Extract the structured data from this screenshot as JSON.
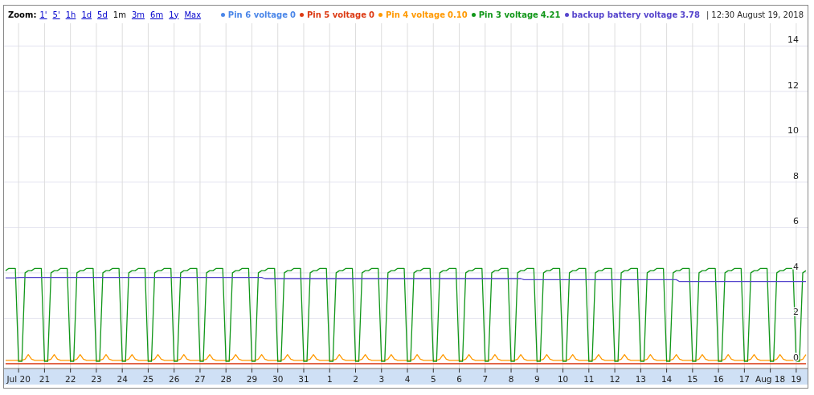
{
  "zoom": {
    "label": "Zoom:",
    "options": [
      {
        "label": "1'",
        "selected": false
      },
      {
        "label": "5'",
        "selected": false
      },
      {
        "label": "1h",
        "selected": false
      },
      {
        "label": "1d",
        "selected": false
      },
      {
        "label": "5d",
        "selected": false
      },
      {
        "label": "1m",
        "selected": true
      },
      {
        "label": "3m",
        "selected": false
      },
      {
        "label": "6m",
        "selected": false
      },
      {
        "label": "1y",
        "selected": false
      },
      {
        "label": "Max",
        "selected": false
      }
    ]
  },
  "legend": [
    {
      "value": "0"
    },
    {
      "value": "0"
    },
    {
      "value": "0.10"
    },
    {
      "value": "4.21"
    },
    {
      "value": "3.78"
    }
  ],
  "separator": "|",
  "timestamp": "12:30 August 19, 2018",
  "chart_data": {
    "type": "line",
    "grid": true,
    "ylim": [
      0,
      15
    ],
    "yticks": [
      0,
      2,
      4,
      6,
      8,
      10,
      12,
      14
    ],
    "categories": [
      null,
      null,
      null,
      null,
      "Jul 20",
      null,
      null,
      null,
      null,
      null,
      null,
      null,
      "21",
      null,
      null,
      null,
      null,
      null,
      null,
      null,
      "22",
      null,
      null,
      null,
      null,
      null,
      null,
      null,
      "23",
      null,
      null,
      null,
      null,
      null,
      null,
      null,
      "24",
      null,
      null,
      null,
      null,
      null,
      null,
      null,
      "25",
      null,
      null,
      null,
      null,
      null,
      null,
      null,
      "26",
      null,
      null,
      null,
      null,
      null,
      null,
      null,
      "27",
      null,
      null,
      null,
      null,
      null,
      null,
      null,
      "28",
      null,
      null,
      null,
      null,
      null,
      null,
      null,
      "29",
      null,
      null,
      null,
      null,
      null,
      null,
      null,
      "30",
      null,
      null,
      null,
      null,
      null,
      null,
      null,
      "31",
      null,
      null,
      null,
      null,
      null,
      null,
      null,
      "1",
      null,
      null,
      null,
      null,
      null,
      null,
      null,
      "2",
      null,
      null,
      null,
      null,
      null,
      null,
      null,
      "3",
      null,
      null,
      null,
      null,
      null,
      null,
      null,
      "4",
      null,
      null,
      null,
      null,
      null,
      null,
      null,
      "5",
      null,
      null,
      null,
      null,
      null,
      null,
      null,
      "6",
      null,
      null,
      null,
      null,
      null,
      null,
      null,
      "7",
      null,
      null,
      null,
      null,
      null,
      null,
      null,
      "8",
      null,
      null,
      null,
      null,
      null,
      null,
      null,
      "9",
      null,
      null,
      null,
      null,
      null,
      null,
      null,
      "10",
      null,
      null,
      null,
      null,
      null,
      null,
      null,
      "11",
      null,
      null,
      null,
      null,
      null,
      null,
      null,
      "12",
      null,
      null,
      null,
      null,
      null,
      null,
      null,
      "13",
      null,
      null,
      null,
      null,
      null,
      null,
      null,
      "14",
      null,
      null,
      null,
      null,
      null,
      null,
      null,
      "15",
      null,
      null,
      null,
      null,
      null,
      null,
      null,
      "16",
      null,
      null,
      null,
      null,
      null,
      null,
      null,
      "17",
      null,
      null,
      null,
      null,
      null,
      null,
      null,
      "Aug 18",
      null,
      null,
      null,
      null,
      null,
      null,
      null,
      "19",
      null,
      null,
      null
    ],
    "series": [
      {
        "name": "Pin 6 voltage",
        "color": "#4a86e8",
        "values": [
          null,
          null,
          null,
          null,
          null,
          null,
          null,
          null,
          null,
          null,
          null,
          null,
          null,
          null,
          null,
          null,
          null,
          null,
          null,
          null,
          null,
          null,
          null,
          null,
          null,
          null,
          null,
          null,
          null,
          null,
          null,
          null,
          null,
          null,
          null,
          null,
          null,
          null,
          null,
          null,
          null,
          null,
          null,
          null,
          null,
          null,
          null,
          null,
          null,
          null,
          null,
          null,
          null,
          null,
          null,
          null,
          null,
          null,
          null,
          null,
          null,
          null,
          null,
          null,
          null,
          null,
          null,
          null,
          null,
          null,
          null,
          null,
          null,
          null,
          null,
          null,
          null,
          null,
          null,
          null,
          null,
          null,
          null,
          null,
          null,
          null,
          null,
          null,
          null,
          null,
          null,
          null,
          null,
          null,
          null,
          null,
          null,
          null,
          null,
          null,
          null,
          null,
          null,
          null,
          null,
          null,
          null,
          null,
          null,
          null,
          null,
          null,
          null,
          null,
          null,
          null,
          null,
          null,
          null,
          null,
          null,
          null,
          null,
          null,
          null,
          null,
          null,
          null,
          null,
          null,
          null,
          null,
          null,
          null,
          null,
          null,
          null,
          null,
          null,
          null,
          null,
          null,
          null,
          null,
          null,
          null,
          null,
          null,
          null,
          null,
          null,
          null,
          null,
          null,
          null,
          null,
          null,
          null,
          null,
          null,
          null,
          null,
          null,
          null,
          null,
          null,
          null,
          null,
          null,
          null,
          null,
          null,
          null,
          null,
          null,
          null,
          null,
          null,
          null,
          null,
          null,
          null,
          null,
          null,
          null,
          null,
          null,
          null,
          null,
          null,
          null,
          null,
          null,
          null,
          null,
          null,
          null,
          null,
          null,
          null,
          null,
          null,
          null,
          null,
          null,
          null,
          null,
          null,
          null,
          null,
          null,
          null,
          null,
          null,
          null,
          null,
          null,
          null,
          null,
          null,
          null,
          null,
          null,
          null,
          null,
          null,
          null,
          null,
          null,
          null,
          null,
          null,
          null,
          null,
          null,
          null,
          null,
          null,
          null,
          null,
          null,
          null,
          null,
          null,
          null,
          null,
          null,
          null
        ]
      },
      {
        "name": "Pin 5 voltage",
        "color": "#dc3912",
        "values": [
          0,
          0,
          0,
          0,
          0,
          0,
          0,
          0,
          0,
          0,
          0,
          0,
          0,
          0,
          0,
          0,
          0,
          0,
          0,
          0,
          0,
          0,
          0,
          0,
          0,
          0,
          0,
          0,
          0,
          0,
          0,
          0,
          0,
          0,
          0,
          0,
          0,
          0,
          0,
          0,
          0,
          0,
          0,
          0,
          0,
          0,
          0,
          0,
          0,
          0,
          0,
          0,
          0,
          0,
          0,
          0,
          0,
          0,
          0,
          0,
          0,
          0,
          0,
          0,
          0,
          0,
          0,
          0,
          0,
          0,
          0,
          0,
          0,
          0,
          0,
          0,
          0,
          0,
          0,
          0,
          0,
          0,
          0,
          0,
          0,
          0,
          0,
          0,
          0,
          0,
          0,
          0,
          0,
          0,
          0,
          0,
          0,
          0,
          0,
          0,
          0,
          0,
          0,
          0,
          0,
          0,
          0,
          0,
          0,
          0,
          0,
          0,
          0,
          0,
          0,
          0,
          0,
          0,
          0,
          0,
          0,
          0,
          0,
          0,
          0,
          0,
          0,
          0,
          0,
          0,
          0,
          0,
          0,
          0,
          0,
          0,
          0,
          0,
          0,
          0,
          0,
          0,
          0,
          0,
          0,
          0,
          0,
          0,
          0,
          0,
          0,
          0,
          0,
          0,
          0,
          0,
          0,
          0,
          0,
          0,
          0,
          0,
          0,
          0,
          0,
          0,
          0,
          0,
          0,
          0,
          0,
          0,
          0,
          0,
          0,
          0,
          0,
          0,
          0,
          0,
          0,
          0,
          0,
          0,
          0,
          0,
          0,
          0,
          0,
          0,
          0,
          0,
          0,
          0,
          0,
          0,
          0,
          0,
          0,
          0,
          0,
          0,
          0,
          0,
          0,
          0,
          0,
          0,
          0,
          0,
          0,
          0,
          0,
          0,
          0,
          0,
          0,
          0,
          0,
          0,
          0,
          0,
          0,
          0,
          0,
          0,
          0,
          0,
          0,
          0,
          0,
          0,
          0,
          0,
          0,
          0,
          0,
          0,
          0,
          0,
          0,
          0,
          0,
          0,
          0,
          0,
          0,
          0
        ]
      },
      {
        "name": "Pin 4 voltage",
        "color": "#ff9900",
        "values": [
          0.15,
          0.15,
          0.15,
          0.15,
          0.15,
          0.15,
          0.2,
          0.4,
          0.2,
          0.15,
          0.15,
          0.15,
          0.15,
          0.15,
          0.2,
          0.4,
          0.2,
          0.15,
          0.15,
          0.15,
          0.15,
          0.15,
          0.2,
          0.4,
          0.2,
          0.15,
          0.15,
          0.15,
          0.15,
          0.15,
          0.2,
          0.4,
          0.2,
          0.15,
          0.15,
          0.15,
          0.15,
          0.15,
          0.2,
          0.4,
          0.2,
          0.15,
          0.15,
          0.15,
          0.15,
          0.15,
          0.2,
          0.4,
          0.2,
          0.15,
          0.15,
          0.15,
          0.15,
          0.15,
          0.2,
          0.4,
          0.2,
          0.15,
          0.15,
          0.15,
          0.15,
          0.15,
          0.2,
          0.4,
          0.2,
          0.15,
          0.15,
          0.15,
          0.15,
          0.15,
          0.2,
          0.4,
          0.2,
          0.15,
          0.15,
          0.15,
          0.15,
          0.15,
          0.2,
          0.4,
          0.2,
          0.15,
          0.15,
          0.15,
          0.15,
          0.15,
          0.2,
          0.4,
          0.2,
          0.15,
          0.15,
          0.15,
          0.15,
          0.15,
          0.2,
          0.4,
          0.2,
          0.15,
          0.15,
          0.15,
          0.15,
          0.15,
          0.2,
          0.4,
          0.2,
          0.15,
          0.15,
          0.15,
          0.15,
          0.15,
          0.2,
          0.4,
          0.2,
          0.15,
          0.15,
          0.15,
          0.15,
          0.15,
          0.2,
          0.4,
          0.2,
          0.15,
          0.15,
          0.15,
          0.15,
          0.15,
          0.2,
          0.4,
          0.2,
          0.15,
          0.15,
          0.15,
          0.15,
          0.15,
          0.2,
          0.4,
          0.2,
          0.15,
          0.15,
          0.15,
          0.15,
          0.15,
          0.2,
          0.4,
          0.2,
          0.15,
          0.15,
          0.15,
          0.15,
          0.15,
          0.2,
          0.4,
          0.2,
          0.15,
          0.15,
          0.15,
          0.15,
          0.15,
          0.2,
          0.4,
          0.2,
          0.15,
          0.15,
          0.15,
          0.15,
          0.15,
          0.2,
          0.4,
          0.2,
          0.15,
          0.15,
          0.15,
          0.15,
          0.15,
          0.2,
          0.4,
          0.2,
          0.15,
          0.15,
          0.15,
          0.15,
          0.15,
          0.2,
          0.4,
          0.2,
          0.15,
          0.15,
          0.15,
          0.15,
          0.15,
          0.2,
          0.4,
          0.2,
          0.15,
          0.15,
          0.15,
          0.15,
          0.15,
          0.2,
          0.4,
          0.2,
          0.15,
          0.15,
          0.15,
          0.15,
          0.15,
          0.2,
          0.4,
          0.2,
          0.15,
          0.15,
          0.15,
          0.15,
          0.15,
          0.2,
          0.4,
          0.2,
          0.15,
          0.15,
          0.15,
          0.15,
          0.15,
          0.2,
          0.4,
          0.2,
          0.15,
          0.15,
          0.15,
          0.15,
          0.15,
          0.2,
          0.4,
          0.2,
          0.15,
          0.15,
          0.15,
          0.15,
          0.15,
          0.2,
          0.4,
          0.2,
          0.15,
          0.15,
          0.15,
          0.15,
          0.15,
          0.2,
          0.4
        ]
      },
      {
        "name": "Pin 3 voltage",
        "color": "#109618",
        "values": [
          4.1,
          4.2,
          4.2,
          4.2,
          0.1,
          0.1,
          4.0,
          4.1,
          4.1,
          4.2,
          4.2,
          4.2,
          0.1,
          0.1,
          4.0,
          4.1,
          4.1,
          4.2,
          4.2,
          4.2,
          0.1,
          0.1,
          4.0,
          4.1,
          4.1,
          4.2,
          4.2,
          4.2,
          0.1,
          0.1,
          4.0,
          4.1,
          4.1,
          4.2,
          4.2,
          4.2,
          0.1,
          0.1,
          4.0,
          4.1,
          4.1,
          4.2,
          4.2,
          4.2,
          0.1,
          0.1,
          4.0,
          4.1,
          4.1,
          4.2,
          4.2,
          4.2,
          0.1,
          0.1,
          4.0,
          4.1,
          4.1,
          4.2,
          4.2,
          4.2,
          0.1,
          0.1,
          4.0,
          4.1,
          4.1,
          4.2,
          4.2,
          4.2,
          0.1,
          0.1,
          4.0,
          4.1,
          4.1,
          4.2,
          4.2,
          4.2,
          0.1,
          0.1,
          4.0,
          4.1,
          4.1,
          4.2,
          4.2,
          4.2,
          0.1,
          0.1,
          4.0,
          4.1,
          4.1,
          4.2,
          4.2,
          4.2,
          0.1,
          0.1,
          4.0,
          4.1,
          4.1,
          4.2,
          4.2,
          4.2,
          0.1,
          0.1,
          4.0,
          4.1,
          4.1,
          4.2,
          4.2,
          4.2,
          0.1,
          0.1,
          4.0,
          4.1,
          4.1,
          4.2,
          4.2,
          4.2,
          0.1,
          0.1,
          4.0,
          4.1,
          4.1,
          4.2,
          4.2,
          4.2,
          0.1,
          0.1,
          4.0,
          4.1,
          4.1,
          4.2,
          4.2,
          4.2,
          0.1,
          0.1,
          4.0,
          4.1,
          4.1,
          4.2,
          4.2,
          4.2,
          0.1,
          0.1,
          4.0,
          4.1,
          4.1,
          4.2,
          4.2,
          4.2,
          0.1,
          0.1,
          4.0,
          4.1,
          4.1,
          4.2,
          4.2,
          4.2,
          0.1,
          0.1,
          4.0,
          4.1,
          4.1,
          4.2,
          4.2,
          4.2,
          0.1,
          0.1,
          4.0,
          4.1,
          4.1,
          4.2,
          4.2,
          4.2,
          0.1,
          0.1,
          4.0,
          4.1,
          4.1,
          4.2,
          4.2,
          4.2,
          0.1,
          0.1,
          4.0,
          4.1,
          4.1,
          4.2,
          4.2,
          4.2,
          0.1,
          0.1,
          4.0,
          4.1,
          4.1,
          4.2,
          4.2,
          4.2,
          0.1,
          0.1,
          4.0,
          4.1,
          4.1,
          4.2,
          4.2,
          4.2,
          0.1,
          0.1,
          4.0,
          4.1,
          4.1,
          4.2,
          4.2,
          4.2,
          0.1,
          0.1,
          4.0,
          4.1,
          4.1,
          4.2,
          4.2,
          4.2,
          0.1,
          0.1,
          4.0,
          4.1,
          4.1,
          4.2,
          4.2,
          4.2,
          0.1,
          0.1,
          4.0,
          4.1,
          4.1,
          4.2,
          4.2,
          4.2,
          0.1,
          0.1,
          4.0,
          4.1,
          4.1,
          4.2,
          4.2,
          4.2,
          0.1,
          0.1,
          4.0,
          4.1
        ]
      },
      {
        "name": "backup battery voltage",
        "color": "#5544cc",
        "values": [
          3.78,
          3.78,
          3.78,
          3.78,
          3.8,
          3.8,
          3.8,
          3.8,
          3.8,
          3.8,
          3.8,
          3.8,
          3.8,
          3.8,
          3.8,
          3.8,
          3.8,
          3.8,
          3.8,
          3.8,
          3.8,
          3.8,
          3.8,
          3.8,
          3.8,
          3.8,
          3.8,
          3.8,
          3.8,
          3.8,
          3.8,
          3.8,
          3.8,
          3.8,
          3.8,
          3.8,
          3.8,
          3.8,
          3.8,
          3.8,
          3.8,
          3.8,
          3.8,
          3.8,
          3.8,
          3.8,
          3.8,
          3.8,
          3.8,
          3.8,
          3.8,
          3.8,
          3.8,
          3.8,
          3.8,
          3.8,
          3.8,
          3.8,
          3.8,
          3.8,
          3.8,
          3.8,
          3.8,
          3.8,
          3.8,
          3.8,
          3.8,
          3.8,
          3.8,
          3.8,
          3.8,
          3.8,
          3.8,
          3.8,
          3.8,
          3.8,
          3.8,
          3.8,
          3.8,
          3.8,
          3.75,
          3.75,
          3.75,
          3.75,
          3.75,
          3.75,
          3.75,
          3.75,
          3.75,
          3.75,
          3.75,
          3.75,
          3.75,
          3.75,
          3.75,
          3.75,
          3.75,
          3.75,
          3.75,
          3.75,
          3.75,
          3.75,
          3.75,
          3.75,
          3.75,
          3.75,
          3.75,
          3.75,
          3.75,
          3.75,
          3.75,
          3.75,
          3.75,
          3.75,
          3.75,
          3.75,
          3.75,
          3.75,
          3.75,
          3.75,
          3.75,
          3.75,
          3.75,
          3.75,
          3.75,
          3.75,
          3.75,
          3.75,
          3.75,
          3.75,
          3.75,
          3.75,
          3.75,
          3.75,
          3.75,
          3.75,
          3.75,
          3.75,
          3.75,
          3.75,
          3.75,
          3.75,
          3.75,
          3.75,
          3.75,
          3.75,
          3.75,
          3.75,
          3.75,
          3.75,
          3.75,
          3.75,
          3.75,
          3.75,
          3.75,
          3.75,
          3.75,
          3.75,
          3.75,
          3.75,
          3.7,
          3.7,
          3.7,
          3.7,
          3.7,
          3.7,
          3.7,
          3.7,
          3.7,
          3.7,
          3.7,
          3.7,
          3.7,
          3.7,
          3.7,
          3.7,
          3.7,
          3.7,
          3.7,
          3.7,
          3.7,
          3.7,
          3.7,
          3.7,
          3.7,
          3.7,
          3.7,
          3.7,
          3.7,
          3.7,
          3.7,
          3.7,
          3.7,
          3.7,
          3.7,
          3.7,
          3.7,
          3.7,
          3.7,
          3.7,
          3.7,
          3.7,
          3.7,
          3.7,
          3.7,
          3.7,
          3.7,
          3.7,
          3.62,
          3.62,
          3.62,
          3.62,
          3.62,
          3.62,
          3.62,
          3.62,
          3.62,
          3.62,
          3.62,
          3.62,
          3.62,
          3.62,
          3.62,
          3.62,
          3.62,
          3.62,
          3.62,
          3.62,
          3.62,
          3.62,
          3.62,
          3.62,
          3.62,
          3.62,
          3.62,
          3.62,
          3.62,
          3.62,
          3.62,
          3.62,
          3.62,
          3.62,
          3.62,
          3.62,
          3.62,
          3.62,
          3.62,
          3.62
        ]
      }
    ]
  }
}
